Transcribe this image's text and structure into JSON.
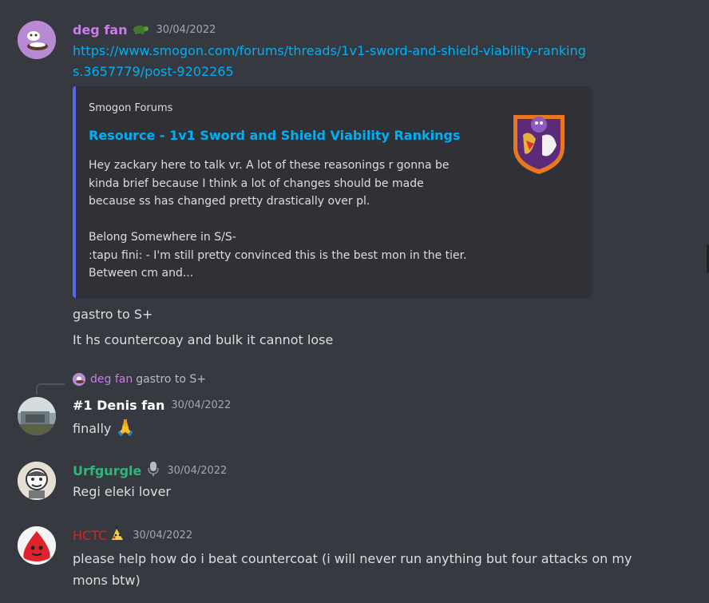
{
  "messages": [
    {
      "username": "deg fan",
      "name_color": "#c77dea",
      "badge_icon": "turtle-icon",
      "timestamp": "30/04/2022",
      "link": "https://www.smogon.com/forums/threads/1v1-sword-and-shield-viability-rankings.3657779/post-9202265",
      "embed": {
        "provider": "Smogon Forums",
        "title": "Resource - 1v1 Sword and Shield Viability Rankings",
        "description": "Hey zackary here to talk vr. A lot of these reasonings r gonna be kinda brief because I think a lot of changes should be made because ss has changed pretty drastically over pl.\n\nBelong Somewhere in S/S-\n:tapu fini: - I'm still pretty convinced this is the best mon in the tier. Between cm and...",
        "accent_color": "#5865f2"
      },
      "lines": [
        "gastro to S+",
        "It hs countercoay and bulk it cannot lose"
      ]
    },
    {
      "reply_to": {
        "username": "deg fan",
        "text": "gastro to S+"
      },
      "username": "#1 Denis fan",
      "name_color": "#ffffff",
      "timestamp": "30/04/2022",
      "text": "finally",
      "emoji": "🙏"
    },
    {
      "username": "Urfgurgle",
      "name_color": "#2fb67c",
      "badge_icon": "microphone-icon",
      "timestamp": "30/04/2022",
      "text": "Regi eleki lover"
    },
    {
      "username": "HCTC",
      "name_color": "#d9231f",
      "badge_icon": "pikachu-icon",
      "timestamp": "30/04/2022",
      "text": "please help how do i beat countercoat (i will never run anything but four attacks on my mons btw)"
    }
  ]
}
